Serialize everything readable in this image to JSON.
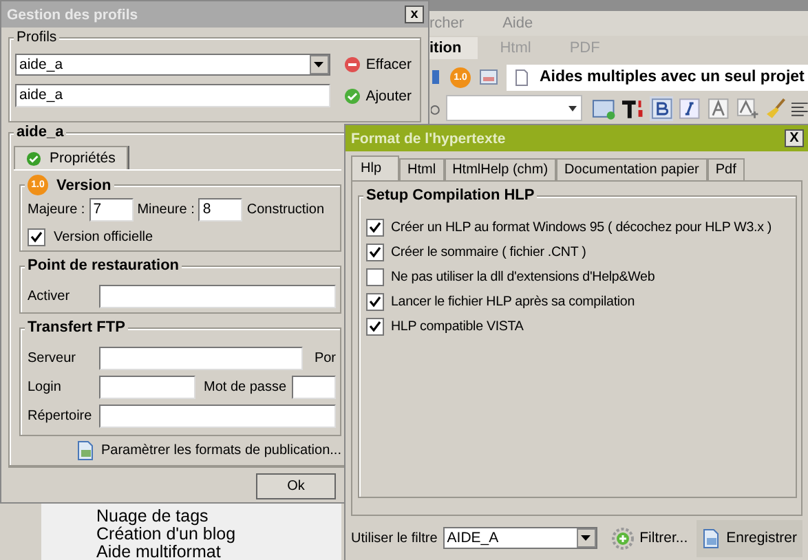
{
  "background_app": {
    "menu": [
      "rcher",
      "Aide"
    ],
    "tabs": [
      {
        "label": "ition",
        "selected": true
      },
      {
        "label": "Html",
        "selected": false
      },
      {
        "label": "PDF",
        "selected": false
      }
    ],
    "version_badge": "1.0",
    "project_title": "Aides multiples avec un seul projet",
    "list_items": [
      "Nuage de tags",
      "Création d'un blog",
      "Aide multiformat"
    ]
  },
  "profiles_window": {
    "title": "Gestion des profils",
    "close_button": "x",
    "profiles_group": {
      "legend": "Profils",
      "profile_select": "aide_a",
      "delete_button": "Effacer",
      "new_profile_input": "aide_a",
      "add_button": "Ajouter"
    },
    "profile_group": {
      "legend": "aide_a",
      "tabs": [
        {
          "label": "Propriétés",
          "selected": true
        }
      ],
      "version": {
        "legend": "Version",
        "badge": "1.0",
        "major_label": "Majeure :",
        "major": "7",
        "minor_label": "Mineure :",
        "minor": "8",
        "build_label": "Construction",
        "official": {
          "label": "Version officielle",
          "checked": true
        }
      },
      "restore_point": {
        "legend": "Point de restauration",
        "activate_label": "Activer"
      },
      "ftp": {
        "legend": "Transfert FTP",
        "server_label": "Serveur",
        "port_label": "Por",
        "login_label": "Login",
        "password_label": "Mot de passe",
        "directory_label": "Répertoire"
      },
      "formats_link": "Paramètrer les formats de publication..."
    },
    "ok_button": "Ok"
  },
  "hypertext_window": {
    "title": "Format de l'hypertexte",
    "close_button": "X",
    "tabs": [
      {
        "label": "Hlp",
        "selected": true
      },
      {
        "label": "Html",
        "selected": false
      },
      {
        "label": "HtmlHelp (chm)",
        "selected": false
      },
      {
        "label": "Documentation papier",
        "selected": false
      },
      {
        "label": "Pdf",
        "selected": false
      }
    ],
    "group_legend": "Setup Compilation HLP",
    "options": [
      {
        "label": "Créer un HLP au format Windows 95 ( décochez pour HLP W3.x )",
        "checked": true
      },
      {
        "label": "Créer le sommaire ( fichier .CNT )",
        "checked": true
      },
      {
        "label": "Ne pas utiliser la dll d'extensions d'Help&Web",
        "checked": false
      },
      {
        "label": "Lancer le fichier HLP après sa compilation",
        "checked": true
      },
      {
        "label": "HLP compatible VISTA",
        "checked": true
      }
    ],
    "filter_label": "Utiliser le filtre",
    "filter_select": "AIDE_A",
    "filter_button": "Filtrer...",
    "save_button": "Enregistrer"
  }
}
